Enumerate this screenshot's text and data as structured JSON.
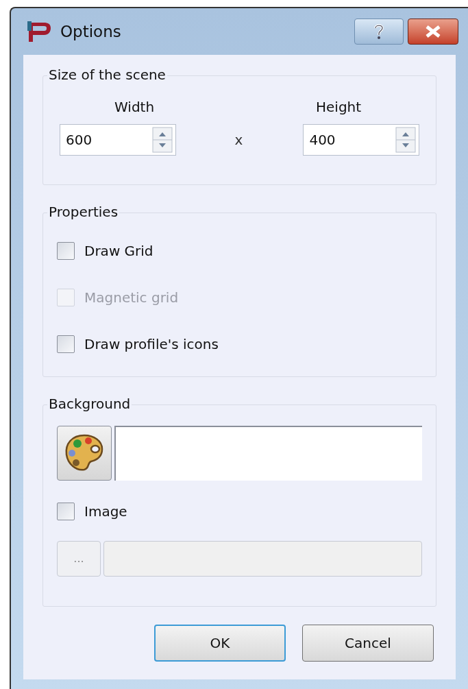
{
  "window": {
    "title": "Options",
    "controls": [
      {
        "kind": "help"
      },
      {
        "kind": "close"
      }
    ]
  },
  "size_group": {
    "title": "Size of the scene",
    "width_label": "Width",
    "height_label": "Height",
    "width_value": "600",
    "times_sign": "x",
    "height_value": "400"
  },
  "properties_group": {
    "title": "Properties",
    "checkboxes": [
      {
        "label": "Draw Grid",
        "checked": false,
        "disabled": false
      },
      {
        "label": "Magnetic grid",
        "checked": false,
        "disabled": true
      },
      {
        "label": "Draw profile's icons",
        "checked": false,
        "disabled": false
      }
    ]
  },
  "background_group": {
    "title": "Background",
    "image_checkbox": {
      "label": "Image",
      "checked": false,
      "disabled": false
    },
    "browse_button": {
      "label": "...",
      "disabled": true
    }
  },
  "buttons": [
    {
      "label": "OK",
      "default": true
    },
    {
      "label": "Cancel",
      "default": false
    }
  ]
}
